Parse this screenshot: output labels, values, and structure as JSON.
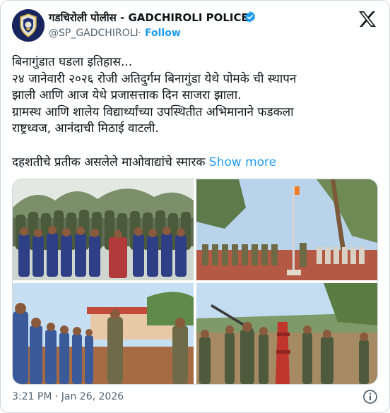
{
  "account": {
    "display_name": "गडचिरोली पोलीस - GADCHIROLI POLICE",
    "handle": "@SP_GADCHIROLI",
    "separator": "·",
    "follow_label": "Follow"
  },
  "icons": {
    "avatar": "police-emblem-avatar",
    "verified": "verified-badge-icon",
    "brand": "x-logo-icon",
    "info": "info-icon"
  },
  "colors": {
    "accent": "#1d9bf0",
    "secondary_text": "#536471",
    "primary_text": "#0f1419",
    "border": "#cfd9de"
  },
  "tweet": {
    "lines": [
      "बिनागुंडात  घडला  इतिहास...",
      "२४ जानेवारी २०२६ रोजी अतिदुर्गम  बिनागुंडा येथे पोमके ची स्थापन",
      "झाली आणि आज येथे  प्रजासत्ताक दिन साजरा झाला.",
      "ग्रामस्थ आणि शालेय विद्यार्थ्यांच्या उपस्थितीत अभिमानाने फडकला",
      "राष्ट्रध्वज, आनंदाची मिठाई वाटली.",
      "",
      "दहशतीचे प्रतीक असलेले माओवाद्यांचे स्मारक"
    ],
    "show_more_label": "Show more"
  },
  "media": {
    "photos": [
      "group-photo-police-students",
      "flag-hoisting-ceremony",
      "sweets-distribution-students",
      "maoist-memorial-demolition"
    ]
  },
  "timestamp": "3:21 PM · Jan 26, 2026"
}
